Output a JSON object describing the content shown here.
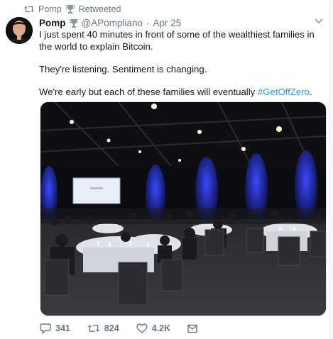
{
  "retweet_context": {
    "name": "Pomp",
    "label": "Retweeted"
  },
  "tweet": {
    "author_name": "Pomp",
    "handle": "@APompliano",
    "separator": "·",
    "date": "Apr 25",
    "text": {
      "line1": "I just spent 40 minutes in front of some of the wealthiest families in the world to explain Bitcoin.",
      "line2": "They're listening. Sentiment is changing.",
      "line3_prefix": "We're early but each of these families will eventually ",
      "hashtag": "#GetOffZero",
      "line3_suffix": "."
    }
  },
  "actions": {
    "replies": "341",
    "retweets": "824",
    "likes": "4.2K"
  },
  "icons": {
    "retweet": "retweet-icon",
    "trophy": "trophy-icon",
    "reply": "reply-icon",
    "like": "heart-icon",
    "share": "share-icon",
    "more": "chevron-down-icon"
  },
  "colors": {
    "accent": "#1da1f2",
    "secondary_text": "#657786",
    "stage_blue": "#1f2bd6"
  }
}
